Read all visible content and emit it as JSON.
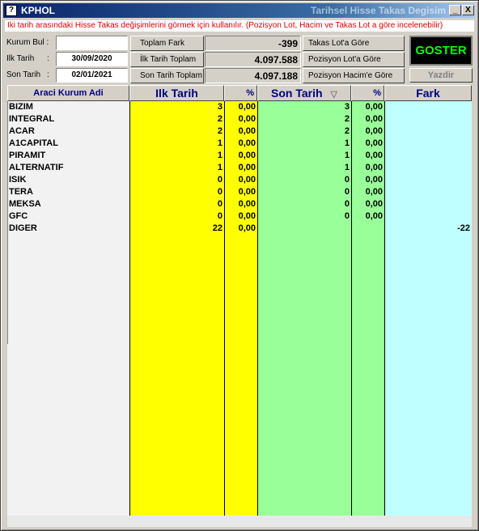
{
  "window": {
    "title": "KPHOL",
    "subtitle": "Tarihsel Hisse Takas Degisim",
    "minimize_label": "_",
    "close_label": "X"
  },
  "hint_text": "Iki tarih arasındaki Hisse Takas değişimlerini görmek için kullanılır. (Pozisyon Lot, Hacim ve Takas Lot a göre incelenebilir)",
  "filters": {
    "kurum_bul_label": "Kurum Bul :",
    "kurum_bul_value": "",
    "ilk_tarih_label": "Ilk Tarih",
    "ilk_tarih_value": "30/09/2020",
    "son_tarih_label": "Son Tarih",
    "son_tarih_value": "02/01/2021",
    "colon": ":"
  },
  "summary": {
    "toplam_fark_label": "Toplam Fark",
    "toplam_fark_value": "-399",
    "ilk_tarih_toplam_label": "İlk Tarih Toplam",
    "ilk_tarih_toplam_value": "4.097.588",
    "son_tarih_toplam_label": "Son Tarih Toplam",
    "son_tarih_toplam_value": "4.097.188"
  },
  "modes": {
    "takas_lot": "Takas Lot'a Göre",
    "pozisyon_lot": "Pozisyon Lot'a Göre",
    "pozisyon_hacim": "Pozisyon Hacim'e Göre"
  },
  "actions": {
    "goster": "GOSTER",
    "yazdir": "Yazdir"
  },
  "table": {
    "headers": {
      "kurum": "Araci Kurum Adi",
      "ilk_tarih": "Ilk Tarih",
      "pct1": "%",
      "son_tarih": "Son Tarih",
      "sort_icon": "▽",
      "pct2": "%",
      "fark": "Fark"
    },
    "colors": {
      "name_col": "#f2f2f2",
      "ilk_col": "#ffff00",
      "son_col": "#99ff99",
      "fark_col": "#c0ffff"
    },
    "rows": [
      {
        "name": "BIZIM",
        "ilk": "3",
        "pct1": "0,00",
        "son": "3",
        "pct2": "0,00",
        "fark": ""
      },
      {
        "name": "INTEGRAL",
        "ilk": "2",
        "pct1": "0,00",
        "son": "2",
        "pct2": "0,00",
        "fark": ""
      },
      {
        "name": "ACAR",
        "ilk": "2",
        "pct1": "0,00",
        "son": "2",
        "pct2": "0,00",
        "fark": ""
      },
      {
        "name": "A1CAPITAL",
        "ilk": "1",
        "pct1": "0,00",
        "son": "1",
        "pct2": "0,00",
        "fark": ""
      },
      {
        "name": "PIRAMIT",
        "ilk": "1",
        "pct1": "0,00",
        "son": "1",
        "pct2": "0,00",
        "fark": ""
      },
      {
        "name": "ALTERNATIF",
        "ilk": "1",
        "pct1": "0,00",
        "son": "1",
        "pct2": "0,00",
        "fark": ""
      },
      {
        "name": "ISIK",
        "ilk": "0",
        "pct1": "0,00",
        "son": "0",
        "pct2": "0,00",
        "fark": ""
      },
      {
        "name": "TERA",
        "ilk": "0",
        "pct1": "0,00",
        "son": "0",
        "pct2": "0,00",
        "fark": ""
      },
      {
        "name": "MEKSA",
        "ilk": "0",
        "pct1": "0,00",
        "son": "0",
        "pct2": "0,00",
        "fark": ""
      },
      {
        "name": "GFC",
        "ilk": "0",
        "pct1": "0,00",
        "son": "0",
        "pct2": "0,00",
        "fark": ""
      },
      {
        "name": "DIGER",
        "ilk": "22",
        "pct1": "0,00",
        "son": "",
        "pct2": "",
        "fark": "-22"
      }
    ]
  }
}
